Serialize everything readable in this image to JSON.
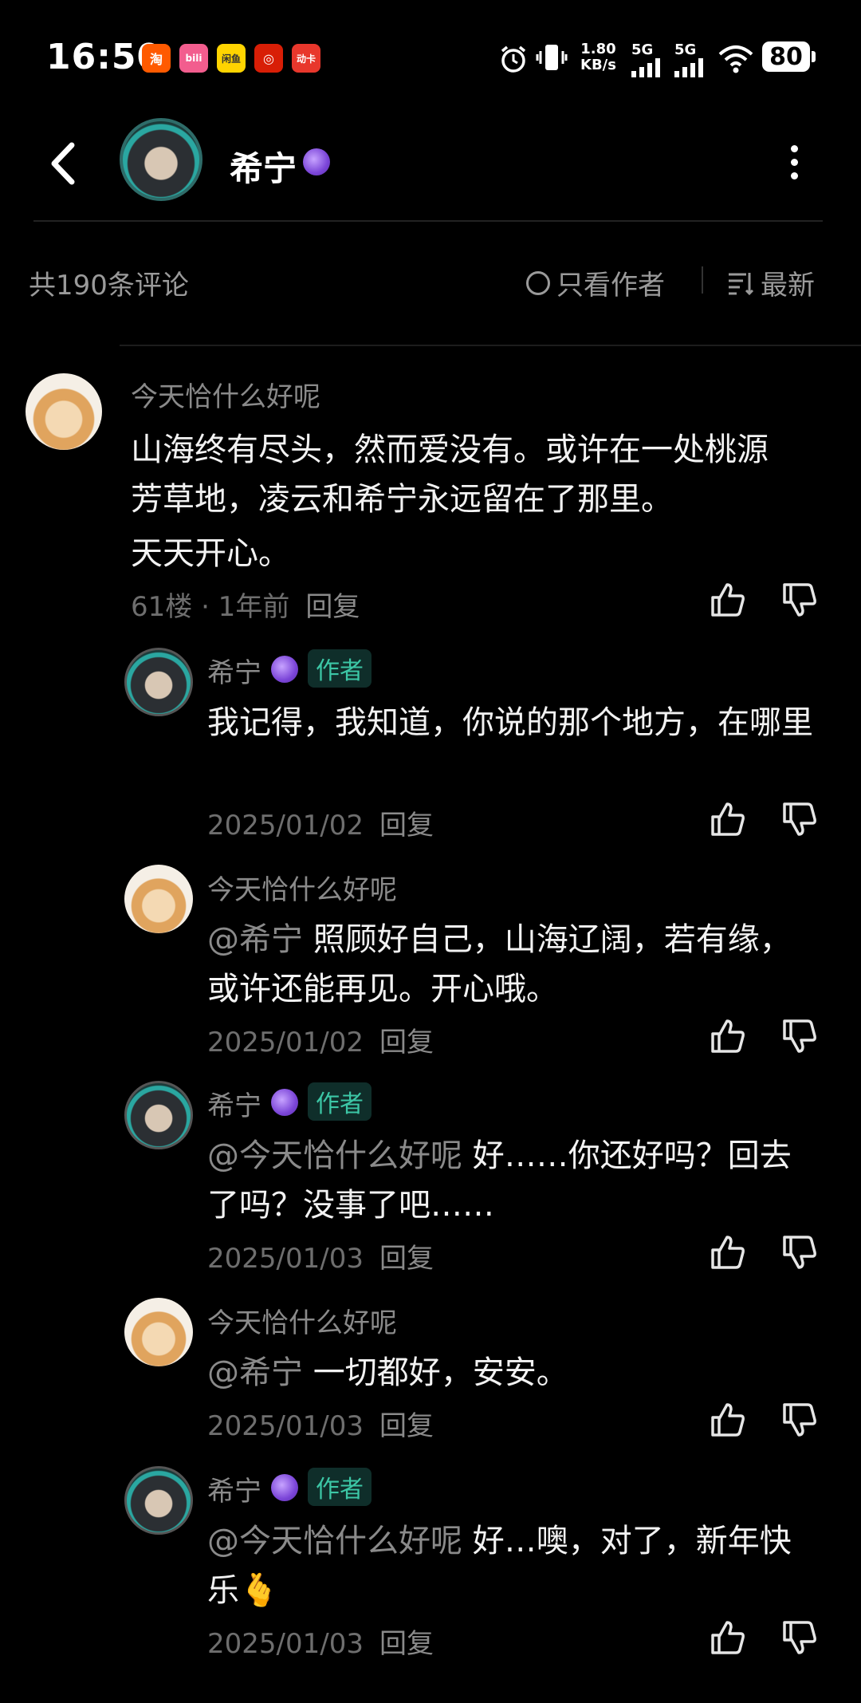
{
  "status_bar": {
    "time": "16:50",
    "app_icons": [
      {
        "name": "taobao-icon",
        "label": "淘",
        "color": "#ff5a00"
      },
      {
        "name": "bilibili-icon",
        "label": "bili",
        "color": "#f25d8e"
      },
      {
        "name": "xianyu-icon",
        "label": "闲鱼",
        "color": "#ffd400"
      },
      {
        "name": "bank-icon",
        "label": "◎",
        "color": "#d81e06"
      },
      {
        "name": "dongchedi-icon",
        "label": "动卡",
        "color": "#e8372c"
      }
    ],
    "net_speed": "1.80",
    "net_speed_unit": "KB/s",
    "sim1": "5G",
    "sim2": "5G",
    "battery": "80"
  },
  "header": {
    "name": "希宁"
  },
  "comment_bar": {
    "count": "共190条评论",
    "only_author": "只看作者",
    "sort": "最新"
  },
  "comments": [
    {
      "user": "今天恰什么好呢",
      "text1": "山海终有尽头，然而爱没有。或许在一处桃源芳草地，凌云和希宁永远留在了那里。",
      "text2": "天天开心。",
      "meta": "61楼 · 1年前",
      "reply": "回复"
    },
    {
      "user": "希宁",
      "tag": "作者",
      "text": "我记得，我知道，你说的那个地方，在哪里",
      "meta": "2025/01/02",
      "reply": "回复"
    },
    {
      "user": "今天恰什么好呢",
      "mention": "@希宁",
      "text": "照顾好自己，山海辽阔，若有缘，或许还能再见。开心哦。",
      "meta": "2025/01/02",
      "reply": "回复"
    },
    {
      "user": "希宁",
      "tag": "作者",
      "mention": "@今天恰什么好呢",
      "text": "好……你还好吗？回去了吗？没事了吧……",
      "meta": "2025/01/03",
      "reply": "回复"
    },
    {
      "user": "今天恰什么好呢",
      "mention": "@希宁",
      "text": "一切都好，安安。",
      "meta": "2025/01/03",
      "reply": "回复"
    },
    {
      "user": "希宁",
      "tag": "作者",
      "mention": "@今天恰什么好呢",
      "text": "好…噢，对了，新年快乐🫰",
      "meta": "2025/01/03",
      "reply": "回复"
    }
  ]
}
